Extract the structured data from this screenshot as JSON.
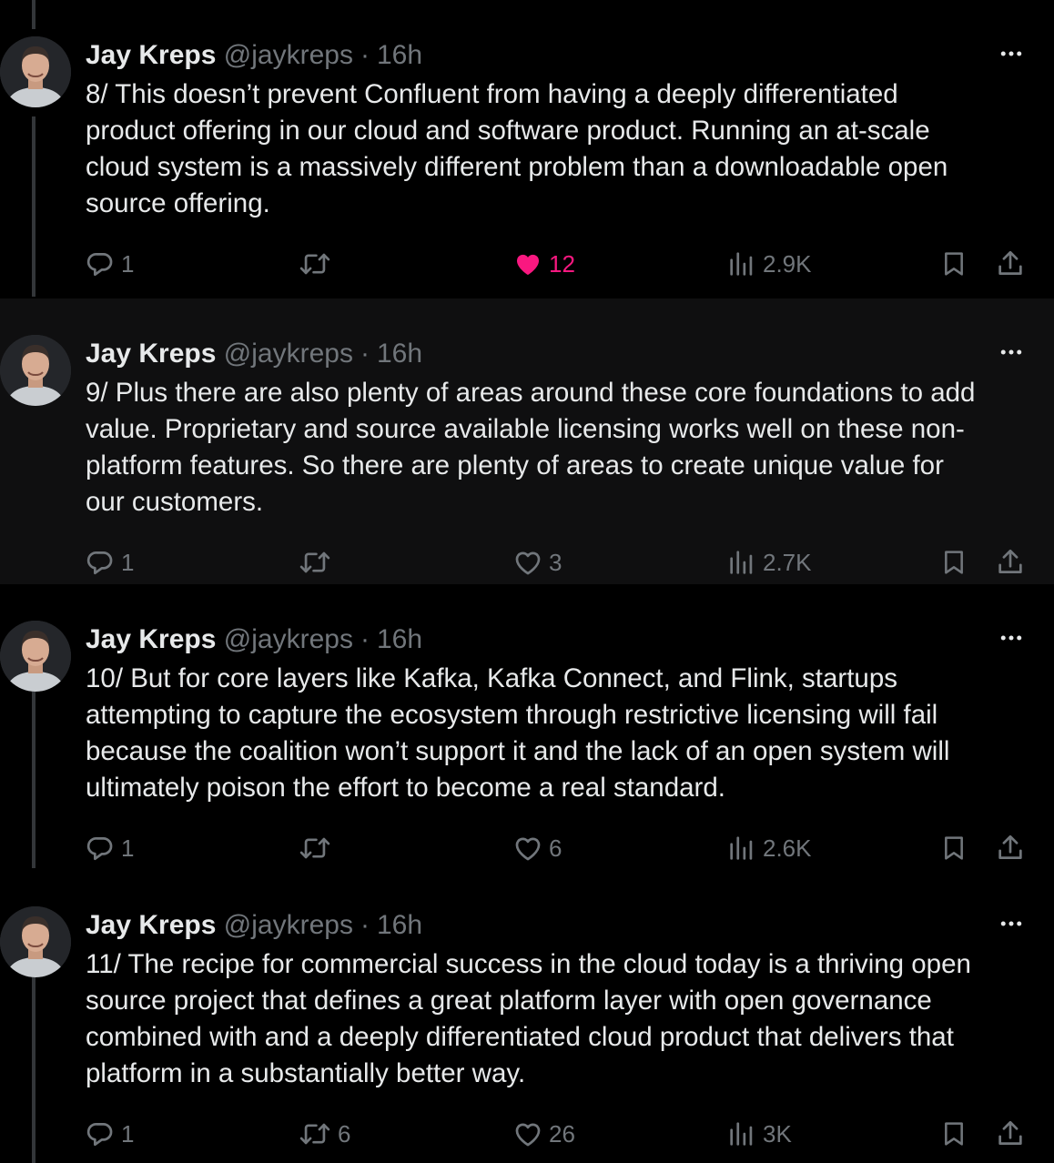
{
  "tweets": [
    {
      "name": "Jay Kreps",
      "handle": "@jaykreps",
      "separator": "·",
      "time": "16h",
      "text": "8/ This doesn’t prevent Confluent from having a deeply differentiated\nproduct offering in our cloud and software product. Running an at-scale\ncloud system is a massively different problem than a downloadable open\nsource offering.",
      "replies": "1",
      "retweets": "",
      "likes": "12",
      "liked": true,
      "views": "2.9K"
    },
    {
      "name": "Jay Kreps",
      "handle": "@jaykreps",
      "separator": "·",
      "time": "16h",
      "text": "9/ Plus there are also plenty of areas around these core foundations to add\nvalue. Proprietary and source available licensing works well on these non-\nplatform features. So there are plenty of areas to create unique value for\nour customers.",
      "replies": "1",
      "retweets": "",
      "likes": "3",
      "liked": false,
      "views": "2.7K"
    },
    {
      "name": "Jay Kreps",
      "handle": "@jaykreps",
      "separator": "·",
      "time": "16h",
      "text": "10/ But for core layers like Kafka, Kafka Connect, and Flink, startups\nattempting to capture the ecosystem through restrictive licensing will fail\nbecause the coalition won’t support it and the lack of an open system will\nultimately poison the effort to become a real standard.",
      "replies": "1",
      "retweets": "",
      "likes": "6",
      "liked": false,
      "views": "2.6K"
    },
    {
      "name": "Jay Kreps",
      "handle": "@jaykreps",
      "separator": "·",
      "time": "16h",
      "text": "11/ The recipe for commercial success in the cloud today is a thriving open\nsource project that defines a great platform layer with open governance\ncombined with and a deeply differentiated cloud product that delivers that\nplatform in a substantially better way.",
      "replies": "1",
      "retweets": "6",
      "likes": "26",
      "liked": false,
      "views": "3K"
    }
  ],
  "colors": {
    "background": "#000000",
    "highlight_background": "#0f0f10",
    "text": "#e7e9ea",
    "muted": "#71767b",
    "like_active": "#f91880",
    "thread_line": "#333639"
  },
  "icons": {
    "reply": "reply-icon",
    "retweet": "retweet-icon",
    "like": "heart-icon",
    "views": "views-icon",
    "bookmark": "bookmark-icon",
    "share": "share-icon",
    "more": "more-icon"
  }
}
